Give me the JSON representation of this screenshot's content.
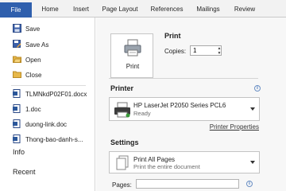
{
  "ribbon": {
    "tabs": [
      {
        "label": "File",
        "active": true
      },
      {
        "label": "Home"
      },
      {
        "label": "Insert"
      },
      {
        "label": "Page Layout"
      },
      {
        "label": "References"
      },
      {
        "label": "Mailings"
      },
      {
        "label": "Review"
      }
    ],
    "file_color": "#2f5fad"
  },
  "nav": {
    "commands": [
      {
        "label": "Save",
        "icon": "save-icon"
      },
      {
        "label": "Save As",
        "icon": "save-as-icon"
      },
      {
        "label": "Open",
        "icon": "open-folder-icon"
      },
      {
        "label": "Close",
        "icon": "close-folder-icon"
      }
    ],
    "recent_docs": [
      {
        "label": "TLMNkdP02F01.docx"
      },
      {
        "label": "1.doc"
      },
      {
        "label": "duong-link.doc"
      },
      {
        "label": "Thong-bao-danh-s..."
      }
    ],
    "info_label": "Info",
    "recent_label": "Recent"
  },
  "print": {
    "heading": "Print",
    "button_label": "Print",
    "copies_label": "Copies:",
    "copies_value": "1"
  },
  "printer": {
    "heading": "Printer",
    "name": "HP LaserJet P2050 Series PCL6",
    "status": "Ready",
    "properties_link": "Printer Properties"
  },
  "settings": {
    "heading": "Settings",
    "selection_title": "Print All Pages",
    "selection_desc": "Print the entire document",
    "pages_label": "Pages:",
    "pages_value": ""
  }
}
